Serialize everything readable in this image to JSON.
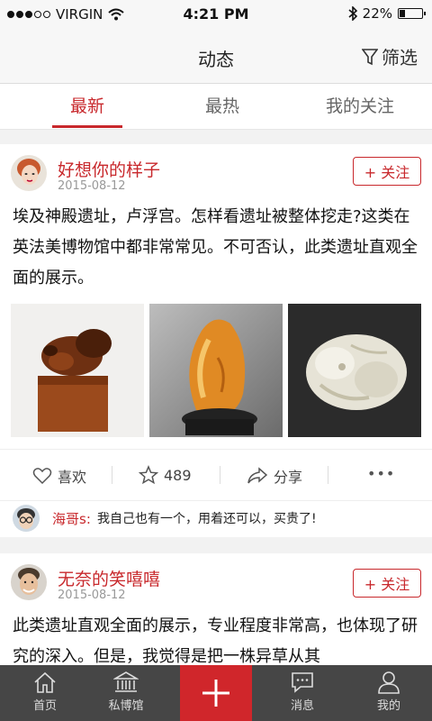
{
  "status": {
    "carrier": "VIRGIN",
    "time": "4:21 PM",
    "battery": "22%",
    "battery_level": 0.22
  },
  "header": {
    "title": "动态",
    "filter_label": "筛选"
  },
  "tabs": [
    {
      "label": "最新",
      "active": true
    },
    {
      "label": "最热",
      "active": false
    },
    {
      "label": "我的关注",
      "active": false
    }
  ],
  "posts": [
    {
      "author": "好想你的样子",
      "date": "2015-08-12",
      "follow_label": "+ 关注",
      "text": "埃及神殿遗址，卢浮宫。怎样看遗址被整体挖走?这类在英法美博物馆中都非常常见。不可否认，此类遗址直观全面的展示。",
      "actions": {
        "like": "喜欢",
        "stars": "489",
        "share": "分享",
        "more": "•••"
      },
      "comment": {
        "name": "海哥s:",
        "text": "我自己也有一个，用着还可以，买贵了!"
      }
    },
    {
      "author": "无奈的笑嘻嘻",
      "date": "2015-08-12",
      "follow_label": "+ 关注",
      "text": "此类遗址直观全面的展示，专业程度非常高，也体现了研究的深入。但是，我觉得是把一株异草从其"
    }
  ],
  "bottom_nav": {
    "home": "首页",
    "museum": "私博馆",
    "messages": "消息",
    "mine": "我的"
  },
  "colors": {
    "accent": "#c8282c",
    "bar": "#2a2a2a"
  }
}
